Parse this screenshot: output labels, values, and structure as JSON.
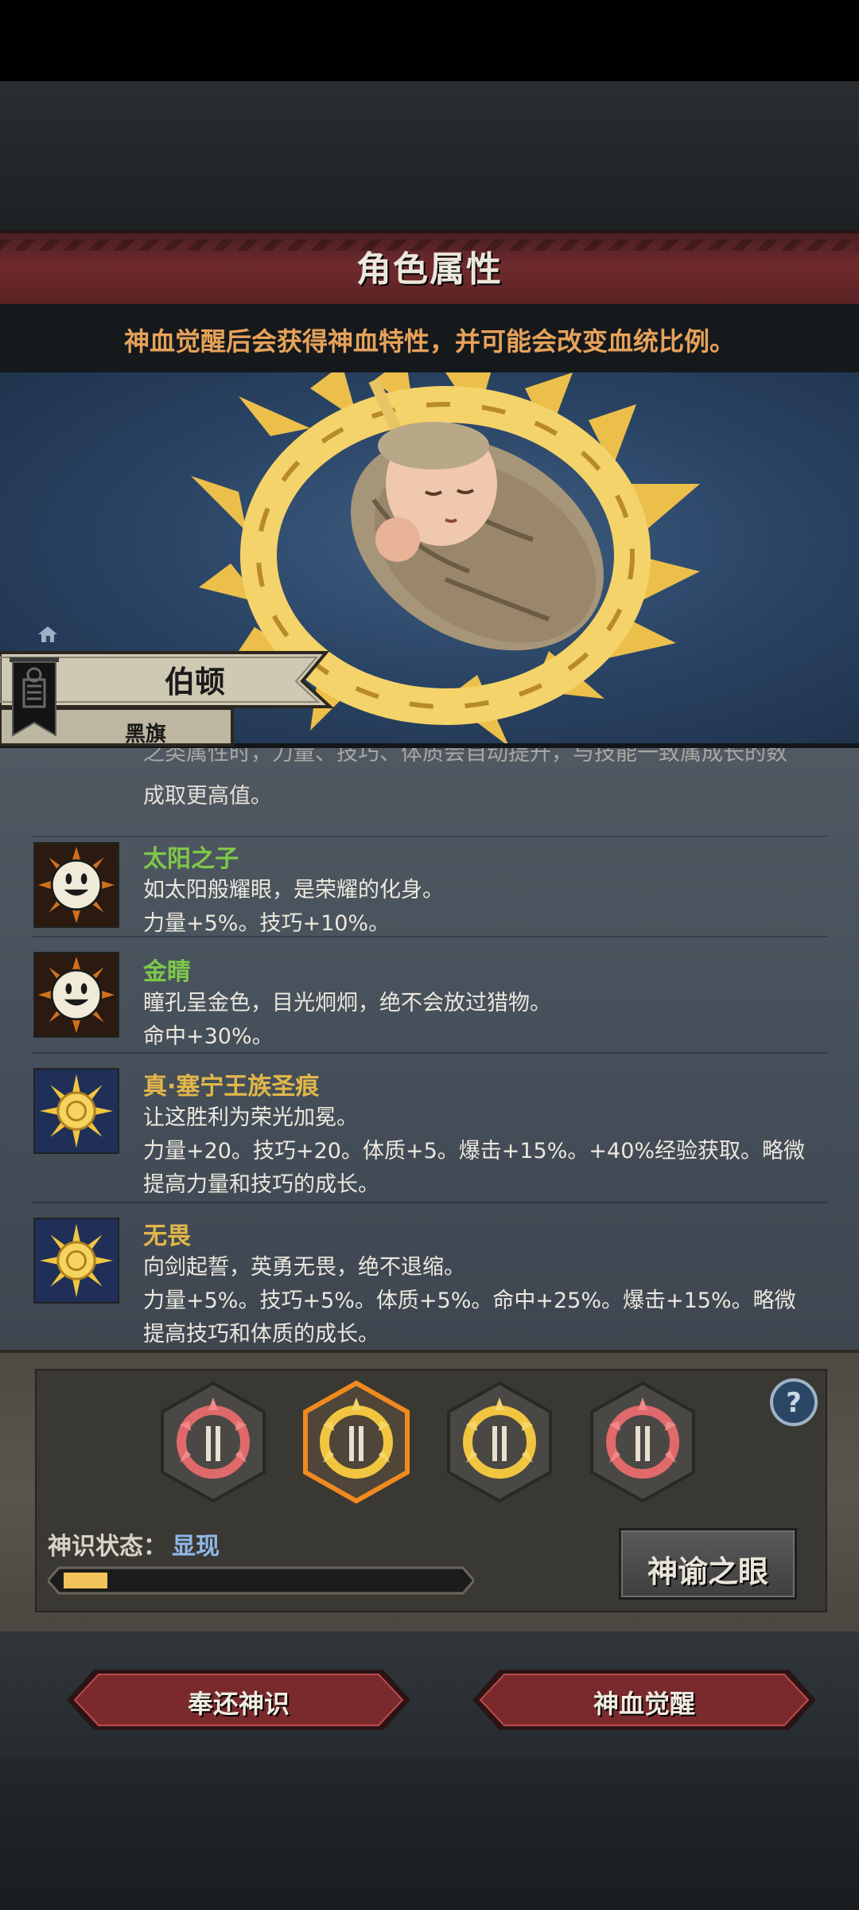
{
  "header": {
    "title": "角色属性",
    "subtitle": "神血觉醒后会获得神血特性，并可能会改变血统比例。"
  },
  "character": {
    "name": "伯顿",
    "faction": "黑旗"
  },
  "trait_list": {
    "fragment_top": "之类属性时，力量、技巧、体质会自动提升，与技能一致属成长的数",
    "fragment_line": "成取更高值。",
    "traits": [
      {
        "icon": "smiley-sun-icon",
        "name": "太阳之子",
        "name_color": "#7ec84a",
        "lines": [
          "如太阳般耀眼，是荣耀的化身。",
          "力量+5%。技巧+10%。"
        ]
      },
      {
        "icon": "smiley-sun-icon",
        "name": "金睛",
        "name_color": "#7ec84a",
        "lines": [
          "瞳孔呈金色，目光炯炯，绝不会放过猎物。",
          "命中+30%。"
        ]
      },
      {
        "icon": "golden-sun-icon",
        "name": "真·塞宁王族圣痕",
        "name_color": "#e2b64a",
        "lines": [
          "让这胜利为荣光加冕。",
          "力量+20。技巧+20。体质+5。爆击+15%。+40%经验获取。略微",
          "提高力量和技巧的成长。"
        ]
      },
      {
        "icon": "golden-sun-icon",
        "name": "无畏",
        "name_color": "#e2b64a",
        "lines": [
          "向剑起誓，英勇无畏，绝不退缩。",
          "力量+5%。技巧+5%。体质+5%。命中+25%。爆击+15%。略微",
          "提高技巧和体质的成长。"
        ]
      }
    ]
  },
  "awakening": {
    "runes": [
      {
        "icon": "red-sun-rune-icon",
        "selected": false
      },
      {
        "icon": "gold-sun-rune-icon",
        "selected": true
      },
      {
        "icon": "gold-sun-rune-icon",
        "selected": false
      },
      {
        "icon": "red-sun-rune-icon",
        "selected": false
      }
    ],
    "help_icon": "question-icon",
    "status_label": "神识状态：",
    "status_value": "显现",
    "progress": 0.11,
    "oracle_button": "神谕之眼"
  },
  "actions": {
    "return_button": "奉还神识",
    "awaken_button": "神血觉醒"
  },
  "colors": {
    "title_bar": "#6f2a2c",
    "subtitle_text": "#e6a25a",
    "status_value": "#8fb8e8",
    "progress_fill": "#f2c35a"
  }
}
